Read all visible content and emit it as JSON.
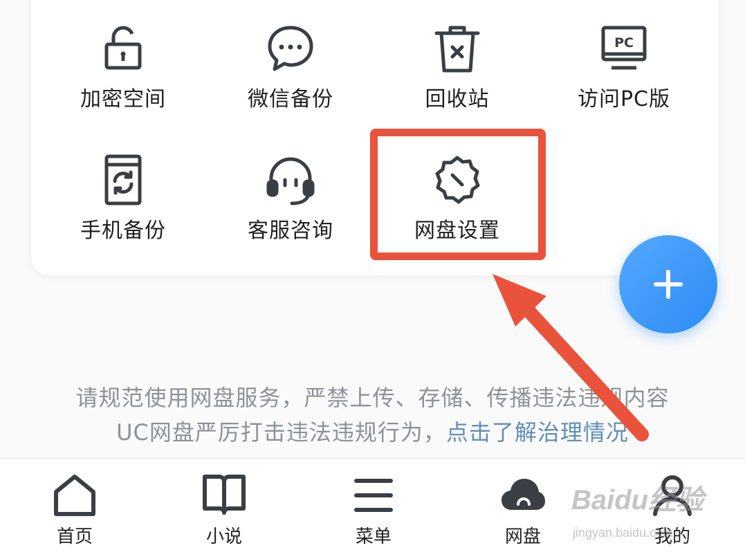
{
  "tools": [
    {
      "label": "加密空间",
      "icon": "lock-icon"
    },
    {
      "label": "微信备份",
      "icon": "chat-bubble-icon"
    },
    {
      "label": "回收站",
      "icon": "trash-icon"
    },
    {
      "label": "访问PC版",
      "icon": "pc-monitor-icon"
    },
    {
      "label": "手机备份",
      "icon": "phone-sync-icon"
    },
    {
      "label": "客服咨询",
      "icon": "headset-icon"
    },
    {
      "label": "网盘设置",
      "icon": "settings-gear-icon"
    }
  ],
  "fab": {
    "icon": "plus-icon"
  },
  "notice": {
    "line1": "请规范使用网盘服务，严禁上传、存储、传播违法违规内容",
    "line2_prefix": "UC网盘严厉打击违法违规行为，",
    "line2_link": "点击了解治理情况"
  },
  "tabs": [
    {
      "label": "首页",
      "icon": "home-icon"
    },
    {
      "label": "小说",
      "icon": "book-icon"
    },
    {
      "label": "菜单",
      "icon": "menu-icon"
    },
    {
      "label": "网盘",
      "icon": "cloud-icon"
    },
    {
      "label": "我的",
      "icon": "user-icon"
    }
  ],
  "watermark": {
    "brand": "Baidu经验",
    "url": "jingyan.baidu.com"
  },
  "colors": {
    "highlight": "#e9533c",
    "fab": "#2c8cf4",
    "link": "#5f8fb8",
    "notice": "#8d9299",
    "icon": "#3a3f45"
  }
}
